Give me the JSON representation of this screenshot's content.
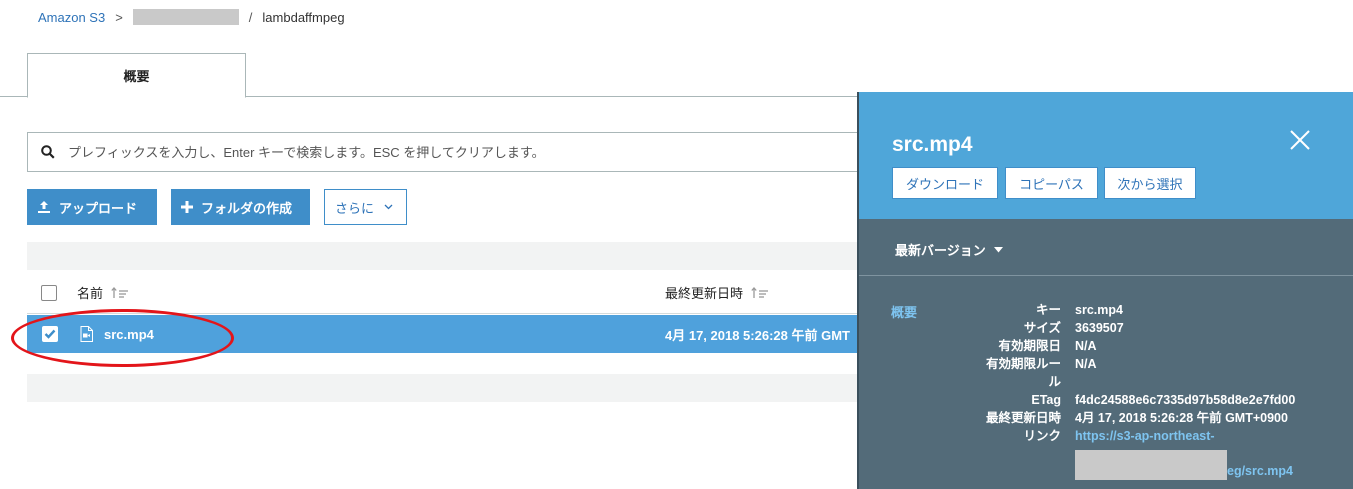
{
  "breadcrumb": {
    "root": "Amazon S3",
    "separator": ">",
    "slash": "/",
    "current": "lambdaffmpeg"
  },
  "tabs": [
    {
      "label": "概要"
    }
  ],
  "search": {
    "placeholder": "プレフィックスを入力し、Enter キーで検索します。ESC を押してクリアします。"
  },
  "toolbar": {
    "upload_label": "アップロード",
    "create_folder_label": "フォルダの作成",
    "more_label": "さらに"
  },
  "table": {
    "columns": {
      "name": "名前",
      "modified": "最終更新日時"
    },
    "rows": [
      {
        "name": "src.mp4",
        "modified": "4月 17, 2018 5:26:28 午前 GMT",
        "selected": true
      }
    ]
  },
  "panel": {
    "title": "src.mp4",
    "buttons": {
      "download": "ダウンロード",
      "copy_path": "コピーパス",
      "select_from": "次から選択"
    },
    "version_label": "最新バージョン",
    "overview_label": "概要",
    "properties": {
      "key_label": "キー",
      "key_value": "src.mp4",
      "size_label": "サイズ",
      "size_value": "3639507",
      "expiry_label": "有効期限日",
      "expiry_value": "N/A",
      "rule_label_1": "有効期限ルー",
      "rule_label_2": "ル",
      "rule_value": "N/A",
      "etag_label": "ETag",
      "etag_value": "f4dc24588e6c7335d97b58d8e2e7fd00",
      "modified_label": "最終更新日時",
      "modified_value": "4月 17, 2018 5:26:28 午前 GMT+0900",
      "link_label": "リンク",
      "link_value_1": "https://s3-ap-northeast-",
      "link_value_2": "eg/src.mp4"
    }
  },
  "colors": {
    "accent": "#3f8ec9",
    "selected_row": "#4fa1dc",
    "panel_bg": "#536b79",
    "panel_head": "#4fa6d9",
    "annotation": "#e3151a"
  }
}
